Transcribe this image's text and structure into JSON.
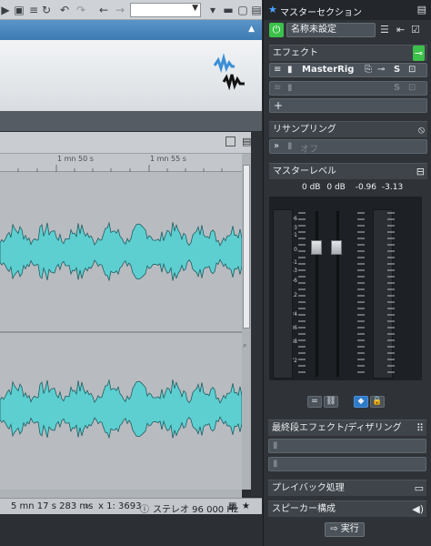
{
  "toolbar": {
    "undo_icon": "undo-icon",
    "redo_icon": "redo-icon",
    "zoom_value": ""
  },
  "ruler": {
    "labels": [
      "1 mn 50 s",
      "1 mn 55 s"
    ]
  },
  "status": {
    "cursor_time": "5 mn 17 s 283 ms",
    "zoom": "x 1: 3693",
    "format": "ステレオ 96 000 Hz"
  },
  "master": {
    "title": "マスターセクション",
    "preset_name": "名称未設定",
    "sections": {
      "effects": "エフェクト",
      "resampling": "リサンプリング",
      "master_level": "マスターレベル",
      "final_effects": "最終段エフェクト/ディザリング",
      "playback": "プレイバック処理",
      "speaker": "スピーカー構成"
    },
    "effects_slots": [
      {
        "name": "MasterRig",
        "active": true
      },
      {
        "name": "",
        "active": false
      }
    ],
    "resampling_value": "オフ",
    "levels": {
      "l_db": "0 dB",
      "r_db": "0 dB",
      "peak_l": "-0.96",
      "peak_r": "-3.13"
    },
    "scale": [
      "+6",
      "+3",
      "+1",
      "0",
      "-1",
      "-3",
      "-6",
      "-12",
      "-24",
      "-36",
      "-48",
      "-72"
    ],
    "execute_label": "実行",
    "accent_color": "#3cc14a"
  }
}
